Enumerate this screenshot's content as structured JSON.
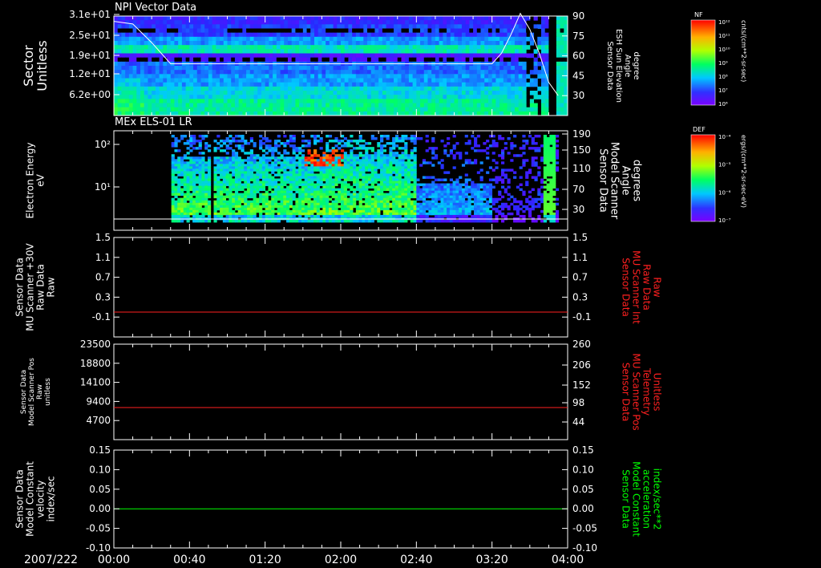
{
  "date_label": "2007/222",
  "time_ticks": [
    "00:00",
    "00:40",
    "01:20",
    "02:00",
    "02:40",
    "03:20",
    "04:00"
  ],
  "colors": {
    "background": "#000000",
    "frame": "#ffffff",
    "red_trace": "#ff2020",
    "green_trace": "#00ff00",
    "red_label": "#ff2020",
    "green_label": "#00ff00"
  },
  "chart_data": [
    {
      "type": "heatmap",
      "title": "NPI Vector Data",
      "ylabel": [
        "Sector",
        "Unitless"
      ],
      "y_ticks": [
        "3.1e+01",
        "2.5e+01",
        "1.9e+01",
        "1.2e+01",
        "6.2e+00"
      ],
      "y2label": [
        "Sensor Data",
        "ESH Sun Elevation",
        "Angle",
        "degree"
      ],
      "y2_ticks": [
        "90",
        "75",
        "60",
        "45",
        "30"
      ],
      "y2lim": [
        15,
        90
      ],
      "colorbar": {
        "label": "NF",
        "units": "cnts/(cm**2-sr-sec)",
        "ticks": [
          "10¹²",
          "10¹¹",
          "10¹⁰",
          "10⁹",
          "10⁸",
          "10⁷",
          "10⁶"
        ]
      },
      "overlay_line": {
        "series": "ESH Sun Elevation Angle",
        "x": [
          "00:00",
          "00:10",
          "00:20",
          "00:30",
          "03:20",
          "03:25",
          "03:30",
          "03:35",
          "03:40",
          "03:45",
          "03:50",
          "03:55"
        ],
        "y": [
          86,
          84,
          70,
          54,
          54,
          62,
          76,
          92,
          80,
          62,
          40,
          30
        ]
      }
    },
    {
      "type": "heatmap",
      "title": "MEx ELS-01 LR",
      "ylabel": [
        "Electron Energy",
        "eV"
      ],
      "y_ticks": [
        "10²",
        "10¹"
      ],
      "y2label": [
        "Sensor Data",
        "Model Scanner",
        "Angle",
        "degrees"
      ],
      "y2_ticks": [
        "190",
        "150",
        "110",
        "70",
        "30"
      ],
      "colorbar": {
        "label": "DEF",
        "units": "ergs/(cm**2-sr-sec-eV)",
        "ticks": [
          "10⁻⁴",
          "10⁻⁵",
          "10⁻⁶",
          "10⁻⁷"
        ]
      }
    },
    {
      "type": "line",
      "ylabel": [
        "Sensor Data",
        "MU Scanner +30V",
        "Raw Data",
        "Raw"
      ],
      "y_ticks": [
        "1.5",
        "1.1",
        "0.7",
        "0.3",
        "-0.1"
      ],
      "ylim": [
        -0.5,
        1.5
      ],
      "y2label": [
        "Sensor Data",
        "MU Scanner Int",
        "Raw Data",
        "Raw"
      ],
      "y2_ticks": [
        "1.5",
        "1.1",
        "0.7",
        "0.3",
        "-0.1"
      ],
      "series": [
        {
          "values": [
            0.0,
            0.0
          ]
        }
      ],
      "x": [
        "00:00",
        "04:00"
      ]
    },
    {
      "type": "line",
      "ylabel": [
        "Sensor Data",
        "Model Scanner Pos",
        "Raw",
        "unitless"
      ],
      "y_ticks": [
        "23500",
        "18800",
        "14100",
        "9400",
        "4700"
      ],
      "ylim": [
        0,
        23500
      ],
      "y2label": [
        "Sensor Data",
        "MU Scanner Pos",
        "Telemetry",
        "Unitless"
      ],
      "y2_ticks": [
        "260",
        "206",
        "152",
        "98",
        "44"
      ],
      "series": [
        {
          "values": [
            7900,
            7900
          ]
        }
      ],
      "x": [
        "00:00",
        "04:00"
      ]
    },
    {
      "type": "line",
      "ylabel": [
        "Sensor Data",
        "Model Constant",
        "velocity",
        "index/sec"
      ],
      "y_ticks": [
        "0.15",
        "0.10",
        "0.05",
        "0.00",
        "-0.05",
        "-0.10"
      ],
      "ylim": [
        -0.1,
        0.15
      ],
      "y2label": [
        "Sensor Data",
        "Model Constant",
        "acceleration",
        "index/sec**2"
      ],
      "y2_ticks": [
        "0.15",
        "0.10",
        "0.05",
        "0.00",
        "-0.05",
        "-0.10"
      ],
      "series": [
        {
          "values": [
            0.0,
            0.0
          ]
        }
      ],
      "x": [
        "00:00",
        "04:00"
      ]
    }
  ]
}
